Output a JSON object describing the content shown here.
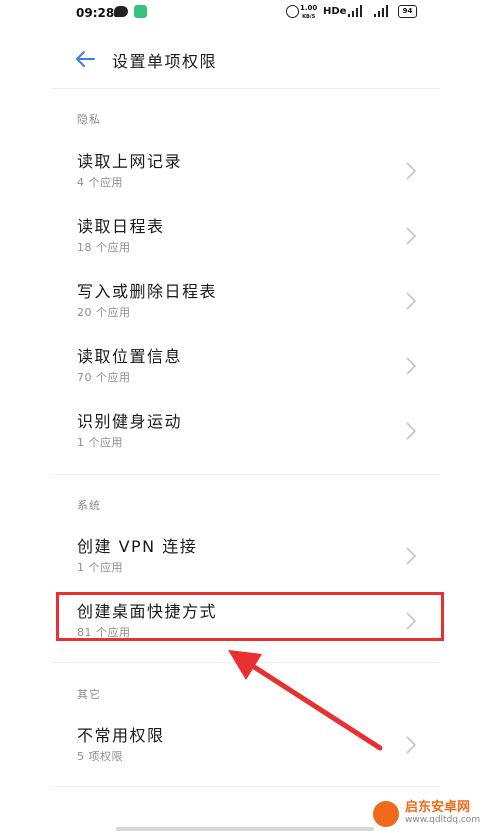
{
  "status_bar": {
    "time": "09:28",
    "speed_top": "1.00",
    "speed_unit": "KB/S",
    "hd": "HDe",
    "battery": "94"
  },
  "header": {
    "title": "设置单项权限"
  },
  "sections": [
    {
      "label": "隐私",
      "items": [
        {
          "title": "读取上网记录",
          "subtitle": "4 个应用"
        },
        {
          "title": "读取日程表",
          "subtitle": "18 个应用"
        },
        {
          "title": "写入或删除日程表",
          "subtitle": "20 个应用"
        },
        {
          "title": "读取位置信息",
          "subtitle": "70 个应用"
        },
        {
          "title": "识别健身运动",
          "subtitle": "1 个应用"
        }
      ]
    },
    {
      "label": "系统",
      "items": [
        {
          "title": "创建 VPN 连接",
          "subtitle": "1 个应用"
        },
        {
          "title": "创建桌面快捷方式",
          "subtitle": "81 个应用"
        }
      ]
    },
    {
      "label": "其它",
      "items": [
        {
          "title": "不常用权限",
          "subtitle": "5 项权限"
        }
      ]
    }
  ],
  "watermark": {
    "text": "启东安卓网",
    "url": "www.qdltdq.com"
  },
  "colors": {
    "accent": "#3b7cf0",
    "highlight": "#e83030"
  }
}
